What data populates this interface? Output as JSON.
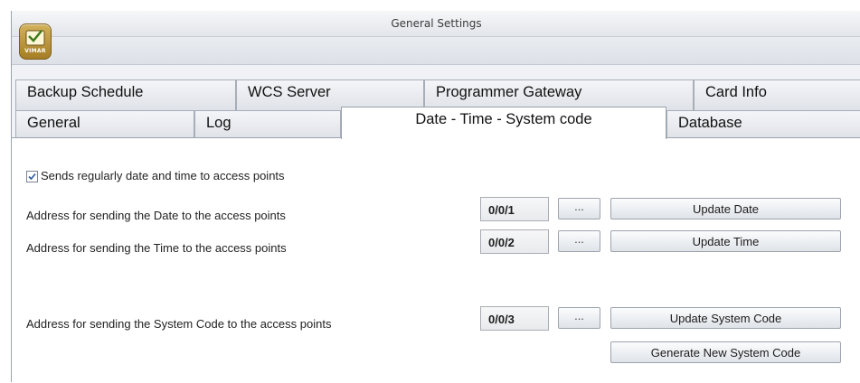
{
  "window": {
    "title": "General Settings",
    "logo_text": "VIMAR"
  },
  "tabs": {
    "row1": [
      "Backup Schedule",
      "WCS Server",
      "Programmer Gateway",
      "Card Info"
    ],
    "row2": [
      "General",
      "Log",
      "Date - Time - System code",
      "Database"
    ],
    "active": "Date - Time - System code"
  },
  "settings": {
    "send_regularly": {
      "label": "Sends regularly date and time to access points",
      "checked": true
    },
    "date": {
      "label": "Address for sending the Date to the access points",
      "address": "0/0/1",
      "browse_label": "...",
      "update_label": "Update Date"
    },
    "time": {
      "label": "Address for sending the Time to the access points",
      "address": "0/0/2",
      "browse_label": "...",
      "update_label": "Update Time"
    },
    "system_code": {
      "label": "Address for sending the System Code to the access points",
      "address": "0/0/3",
      "browse_label": "...",
      "update_label": "Update System Code",
      "generate_label": "Generate New System Code"
    }
  }
}
